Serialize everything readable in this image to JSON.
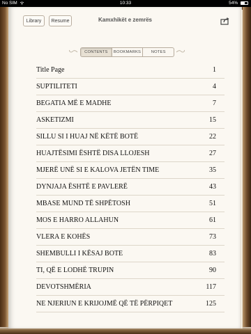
{
  "status_bar": {
    "carrier": "No SIM",
    "time": "10:33",
    "battery_text": "54%",
    "battery_level": 0.54
  },
  "toolbar": {
    "library_label": "Library",
    "resume_label": "Resume",
    "book_title": "Kamxhikët e zemrës",
    "share_icon": "share-icon"
  },
  "tabs": [
    {
      "label": "CONTENTS",
      "active": true
    },
    {
      "label": "BOOKMARKS",
      "active": false
    },
    {
      "label": "NOTES",
      "active": false
    }
  ],
  "toc": [
    {
      "title": "Title Page",
      "page": "1"
    },
    {
      "title": "SUPTILITETI",
      "page": "4"
    },
    {
      "title": "BEGATIA MË E MADHE",
      "page": "7"
    },
    {
      "title": "ASKETIZMI",
      "page": "15"
    },
    {
      "title": "SILLU SI I HUAJ NË KËTË BOTË",
      "page": "22"
    },
    {
      "title": "HUAJTËSIMI ËSHTË DISA LLOJESH",
      "page": "27"
    },
    {
      "title": "MJERË UNË SI E KALOVA JETËN TIME",
      "page": "35"
    },
    {
      "title": "DYNJAJA ËSHTË E PAVLERË",
      "page": "43"
    },
    {
      "title": "MBASE MUND TË SHPËTOSH",
      "page": "51"
    },
    {
      "title": "MOS E HARRO ALLAHUN",
      "page": "61"
    },
    {
      "title": "VLERA E KOHËS",
      "page": "73"
    },
    {
      "title": "SHEMBULLI I KËSAJ BOTE",
      "page": "83"
    },
    {
      "title": "TI, QË E LODHË TRUPIN",
      "page": "90"
    },
    {
      "title": "DEVOTSHMËRIA",
      "page": "117"
    },
    {
      "title": "NE NJERIUN E KRIJOJMË QË TË PËRPIQET",
      "page": "125"
    }
  ]
}
